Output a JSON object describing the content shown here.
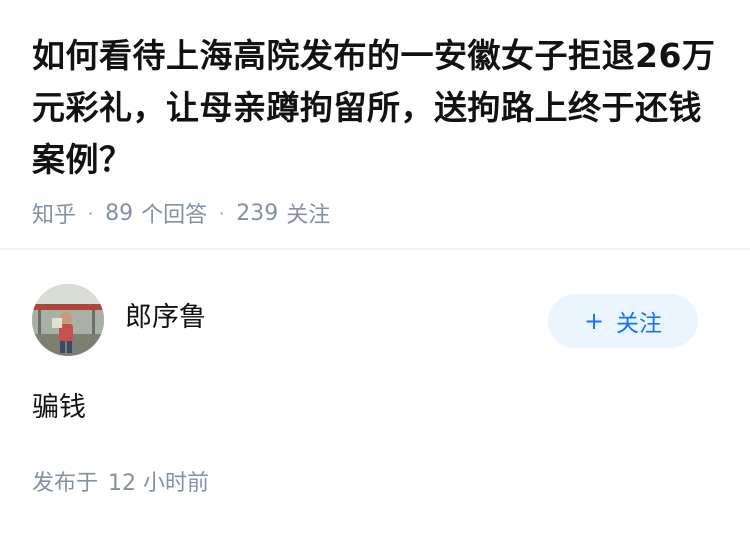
{
  "question": {
    "title": "如何看待上海高院发布的一安徽女子拒退26万元彩礼，让母亲蹲拘留所，送拘路上终于还钱案例？",
    "source": "知乎",
    "answer_count": "89",
    "answer_label": "个回答",
    "follow_count": "239",
    "follow_label": "关注"
  },
  "author": {
    "name": "郎序鲁",
    "follow_button_label": "关注",
    "follow_button_icon": "plus-icon"
  },
  "answer": {
    "content": "骗钱",
    "time_prefix": "发布于",
    "time_value": "12 小时前"
  },
  "colors": {
    "meta_text": "#8590a6",
    "accent": "#1772f6",
    "follow_bg": "#ebf5ff"
  }
}
